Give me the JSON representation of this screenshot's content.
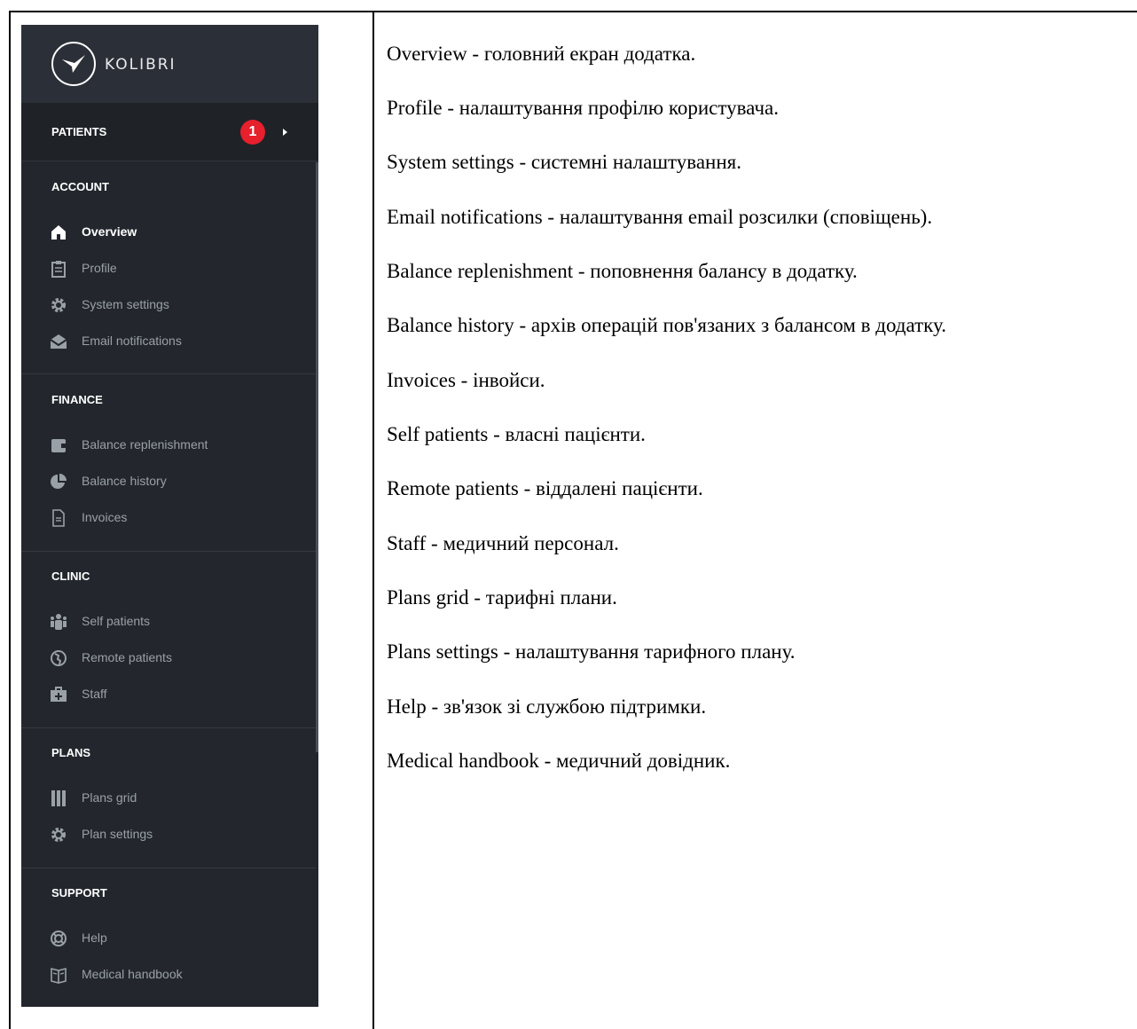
{
  "sidebar": {
    "logo_text": "KOLIBRI",
    "patients": {
      "label": "PATIENTS",
      "badge": "1"
    },
    "sections": {
      "account": {
        "title": "ACCOUNT",
        "items": [
          "Overview",
          "Profile",
          "System settings",
          "Email notifications"
        ]
      },
      "finance": {
        "title": "FINANCE",
        "items": [
          "Balance replenishment",
          "Balance history",
          "Invoices"
        ]
      },
      "clinic": {
        "title": "CLINIC",
        "items": [
          "Self patients",
          "Remote patients",
          "Staff"
        ]
      },
      "plans": {
        "title": "PLANS",
        "items": [
          "Plans grid",
          "Plan settings"
        ]
      },
      "support": {
        "title": "SUPPORT",
        "items": [
          "Help",
          "Medical handbook"
        ]
      }
    },
    "active_item": "Overview",
    "colors": {
      "background": "#23272d",
      "badge": "#e6202c",
      "active_text": "#ffffff",
      "inactive_text": "#9aa0a8"
    }
  },
  "descriptions": [
    "Overview - головний екран додатка.",
    "Profile - налаштування профілю користувача.",
    "System settings - системні налаштування.",
    "Email notifications - налаштування email розсилки (сповіщень).",
    "Balance replenishment - поповнення балансу в додатку.",
    "Balance history - архів операцій пов'язаних з балансом в додатку.",
    "Invoices - інвойси.",
    "Self patients - власні пацієнти.",
    "Remote patients - віддалені пацієнти.",
    "Staff - медичний персонал.",
    "Plans grid - тарифні плани.",
    "Plans settings - налаштування тарифного плану.",
    "Help - зв'язок зі службою підтримки.",
    "Medical handbook - медичний довідник."
  ]
}
